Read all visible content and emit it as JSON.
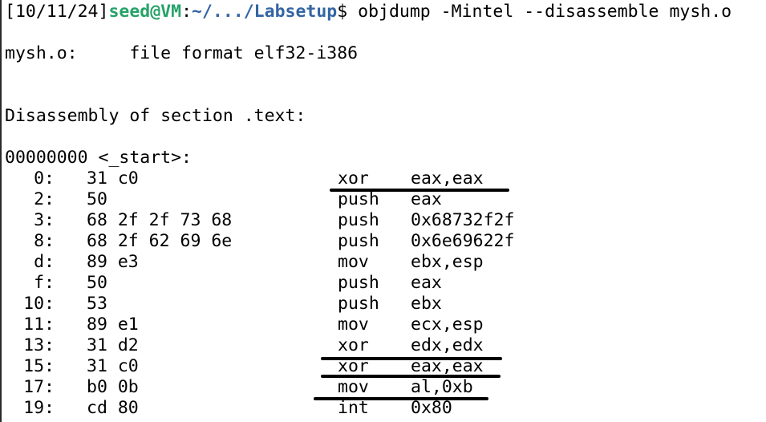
{
  "terminal": {
    "prompt": {
      "time": "[10/11/24]",
      "user_host": "seed@VM",
      "colon": ":",
      "path": "~/.../Labsetup",
      "dollar": "$ ",
      "command": "objdump -Mintel --disassemble mysh.o"
    },
    "file_header": "mysh.o:     file format elf32-i386",
    "section_header": "Disassembly of section .text:",
    "symbol_header": "00000000 <_start>:",
    "instructions": [
      {
        "addr": "0:",
        "bytes": "31 c0",
        "mnemonic": "xor",
        "operands": "eax,eax"
      },
      {
        "addr": "2:",
        "bytes": "50",
        "mnemonic": "push",
        "operands": "eax"
      },
      {
        "addr": "3:",
        "bytes": "68 2f 2f 73 68",
        "mnemonic": "push",
        "operands": "0x68732f2f"
      },
      {
        "addr": "8:",
        "bytes": "68 2f 62 69 6e",
        "mnemonic": "push",
        "operands": "0x6e69622f"
      },
      {
        "addr": "d:",
        "bytes": "89 e3",
        "mnemonic": "mov",
        "operands": "ebx,esp"
      },
      {
        "addr": "f:",
        "bytes": "50",
        "mnemonic": "push",
        "operands": "eax"
      },
      {
        "addr": "10:",
        "bytes": "53",
        "mnemonic": "push",
        "operands": "ebx"
      },
      {
        "addr": "11:",
        "bytes": "89 e1",
        "mnemonic": "mov",
        "operands": "ecx,esp"
      },
      {
        "addr": "13:",
        "bytes": "31 d2",
        "mnemonic": "xor",
        "operands": "edx,edx"
      },
      {
        "addr": "15:",
        "bytes": "31 c0",
        "mnemonic": "xor",
        "operands": "eax,eax"
      },
      {
        "addr": "17:",
        "bytes": "b0 0b",
        "mnemonic": "mov",
        "operands": "al,0xb"
      },
      {
        "addr": "19:",
        "bytes": "cd 80",
        "mnemonic": "int",
        "operands": "0x80"
      }
    ],
    "colors": {
      "host": "#26a269",
      "path": "#3465a4",
      "text": "#000000",
      "background": "#ffffff"
    }
  }
}
